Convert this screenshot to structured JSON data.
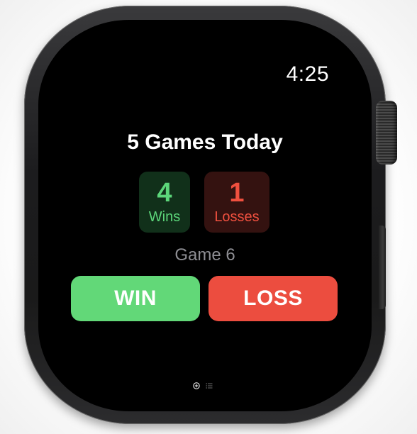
{
  "status": {
    "time": "4:25"
  },
  "main": {
    "title": "5 Games Today",
    "stats": {
      "wins": {
        "value": "4",
        "label": "Wins"
      },
      "losses": {
        "value": "1",
        "label": "Losses"
      }
    },
    "game_label": "Game 6",
    "buttons": {
      "win": "WIN",
      "loss": "LOSS"
    }
  },
  "page_indicator": {
    "icons": [
      "plus-circle-icon",
      "list-icon"
    ],
    "current": 0
  },
  "colors": {
    "win_green": "#62d878",
    "loss_red": "#ec4d3f",
    "wins_text": "#5cd67a",
    "losses_text": "#f0503f"
  }
}
